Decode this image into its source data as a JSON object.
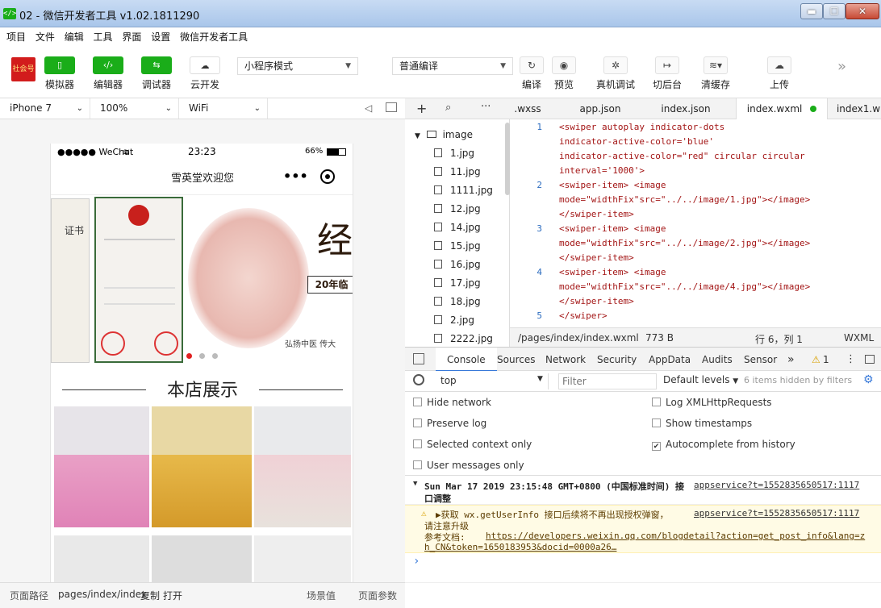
{
  "window": {
    "icon_text": "</>",
    "title": "02 - 微信开发者工具 v1.02.1811290",
    "min_label": "▬",
    "max_label": "☐",
    "close_label": "✕"
  },
  "menu": [
    "项目",
    "文件",
    "编辑",
    "工具",
    "界面",
    "设置",
    "微信开发者工具"
  ],
  "toolbar": {
    "avatar_text": "社会号",
    "buttons": [
      {
        "label": "模拟器",
        "icon": "▯"
      },
      {
        "label": "编辑器",
        "icon": "‹/›"
      },
      {
        "label": "调试器",
        "icon": "⇆"
      },
      {
        "label": "云开发",
        "icon": "☁"
      }
    ],
    "mode_select": "小程序模式",
    "compile_select": "普通编译",
    "actions": [
      {
        "label": "编译",
        "icon": "↻"
      },
      {
        "label": "预览",
        "icon": "◉"
      },
      {
        "label": "真机调试",
        "icon": "✲"
      },
      {
        "label": "切后台",
        "icon": "↦"
      },
      {
        "label": "清缓存",
        "icon": "≋▾"
      },
      {
        "label": "上传",
        "icon": "☁"
      }
    ],
    "more": "»"
  },
  "simulator": {
    "device": "iPhone 7",
    "zoom": "100%",
    "network": "WiFi",
    "phone": {
      "carrier": "●●●●● WeChat",
      "time": "23:23",
      "battery": "66%",
      "nav_title": "雪英堂欢迎您",
      "nav_dots": "•••",
      "banner_text_1": "经",
      "banner_text_2": "20年临",
      "banner_text_3": "弘扬中医  传大",
      "cert_title": "证书",
      "section_title": "本店展示"
    }
  },
  "bottombar": {
    "path_label": "页面路径",
    "path": "pages/index/index",
    "copy": "复制",
    "open": "打开",
    "scene": "场景值",
    "params": "页面参数"
  },
  "filetree": {
    "folder": "image",
    "files": [
      "1.jpg",
      "11.jpg",
      "1111.jpg",
      "12.jpg",
      "14.jpg",
      "15.jpg",
      "16.jpg",
      "17.jpg",
      "18.jpg",
      "2.jpg",
      "2222.jpg"
    ]
  },
  "editor": {
    "tabs": [
      ".wxss",
      "app.json",
      "index.json",
      "index.wxml",
      "index1.w"
    ],
    "lines": [
      {
        "no": "1",
        "text": "<swiper autoplay indicator-dots"
      },
      {
        "no": "",
        "text": "indicator-active-color='blue'"
      },
      {
        "no": "",
        "text": "indicator-active-color=\"red\" circular circular"
      },
      {
        "no": "",
        "text": "interval='1000'>"
      },
      {
        "no": "2",
        "text": "<swiper-item> <image"
      },
      {
        "no": "",
        "text": "mode=\"widthFix\"src=\"../../image/1.jpg\"></image>"
      },
      {
        "no": "",
        "text": "</swiper-item>"
      },
      {
        "no": "3",
        "text": "<swiper-item> <image"
      },
      {
        "no": "",
        "text": "mode=\"widthFix\"src=\"../../image/2.jpg\"></image>"
      },
      {
        "no": "",
        "text": "</swiper-item>"
      },
      {
        "no": "4",
        "text": "<swiper-item> <image"
      },
      {
        "no": "",
        "text": "mode=\"widthFix\"src=\"../../image/4.jpg\"></image>"
      },
      {
        "no": "",
        "text": "</swiper-item>"
      },
      {
        "no": "5",
        "text": "</swiper>"
      }
    ],
    "status_path": "/pages/index/index.wxml",
    "status_size": "773 B",
    "status_pos": "行 6，列 1",
    "status_lang": "WXML"
  },
  "devtools": {
    "tabs": [
      "Console",
      "Sources",
      "Network",
      "Security",
      "AppData",
      "Audits",
      "Sensor"
    ],
    "more": "»",
    "warn_count": "1",
    "context": "top",
    "filter_placeholder": "Filter",
    "levels": "Default levels",
    "hidden": "6 items hidden by filters",
    "settings_left": [
      "Hide network",
      "Preserve log",
      "Selected context only",
      "User messages only"
    ],
    "settings_right": [
      "Log XMLHttpRequests",
      "Show timestamps",
      "Autocomplete from history"
    ],
    "log1_text": "Sun Mar 17 2019 23:15:48 GMT+0800 (中国标准时间) 接",
    "log1_text2": "口调整",
    "log1_link": "appservice?t=1552835650517:1117",
    "warn_text": "▶获取 wx.getUserInfo 接口后续将不再出现授权弹窗，",
    "warn_text2": "请注意升级",
    "warn_doc_label": "参考文档:",
    "warn_link": "appservice?t=1552835650517:1117",
    "warn_url": "https://developers.weixin.qq.com/blogdetail?action=get_post_info&lang=z",
    "warn_url2": "h_CN&token=1650183953&docid=0000a26…",
    "prompt": "›"
  },
  "colors": {
    "green": "#1aad19",
    "code_red": "#a31515",
    "line_blue": "#2b6bbf",
    "warn_bg": "#fffbe5"
  }
}
